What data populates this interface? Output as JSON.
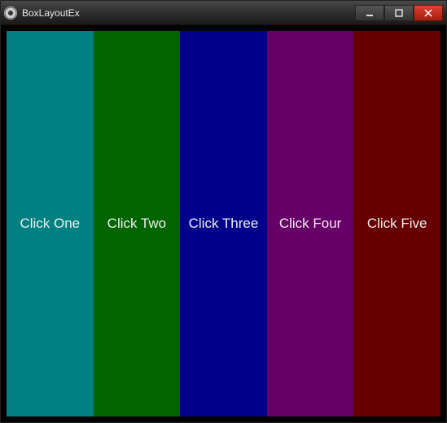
{
  "window": {
    "title": "BoxLayoutEx"
  },
  "panels": {
    "p1": {
      "label": "Click One",
      "color": "#008080"
    },
    "p2": {
      "label": "Click Two",
      "color": "#006400"
    },
    "p3": {
      "label": "Click Three",
      "color": "#00008b"
    },
    "p4": {
      "label": "Click Four",
      "color": "#660066"
    },
    "p5": {
      "label": "Click Five",
      "color": "#660000"
    }
  }
}
